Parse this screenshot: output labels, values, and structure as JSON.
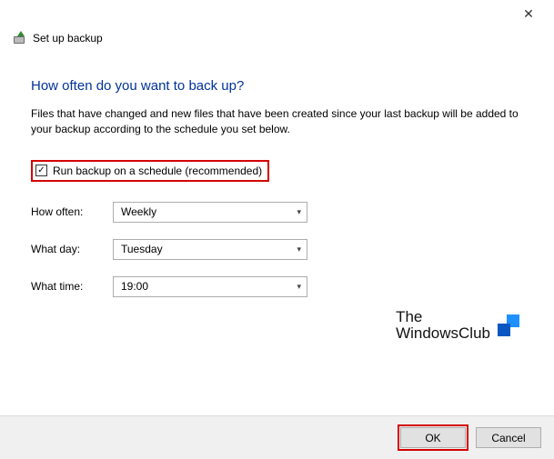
{
  "titlebar": {
    "close_glyph": "✕"
  },
  "header": {
    "title": "Set up backup"
  },
  "page": {
    "heading": "How often do you want to back up?",
    "description": "Files that have changed and new files that have been created since your last backup will be added to your backup according to the schedule you set below."
  },
  "schedule": {
    "checkbox_label": "Run backup on a schedule (recommended)",
    "checkbox_checked": "✓",
    "rows": {
      "how_often": {
        "label": "How often:",
        "value": "Weekly"
      },
      "what_day": {
        "label": "What day:",
        "value": "Tuesday"
      },
      "what_time": {
        "label": "What time:",
        "value": "19:00"
      }
    }
  },
  "watermark": {
    "line1": "The",
    "line2": "WindowsClub"
  },
  "footer": {
    "ok": "OK",
    "cancel": "Cancel"
  }
}
